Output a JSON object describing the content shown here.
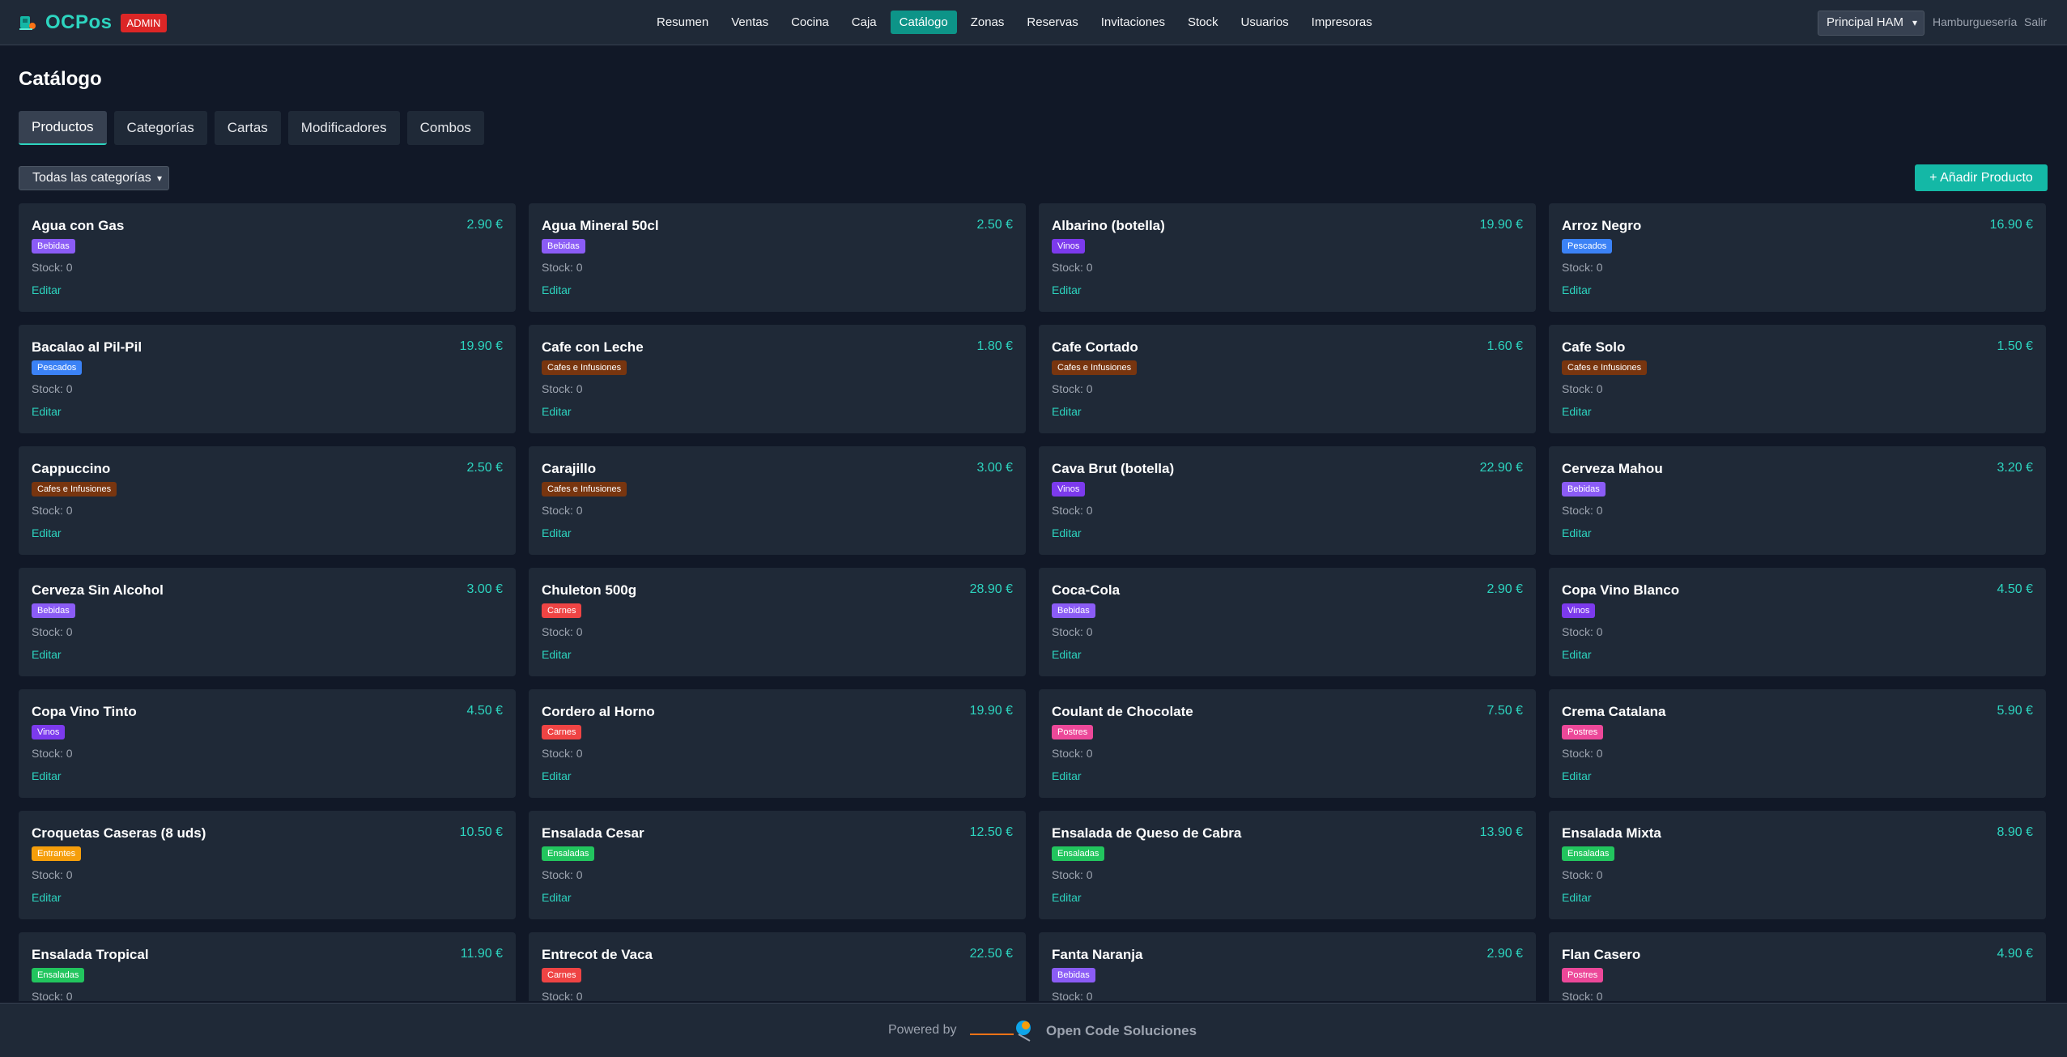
{
  "header": {
    "brand": "OCPos",
    "badge": "ADMIN",
    "nav": [
      {
        "label": "Resumen",
        "active": false
      },
      {
        "label": "Ventas",
        "active": false
      },
      {
        "label": "Cocina",
        "active": false
      },
      {
        "label": "Caja",
        "active": false
      },
      {
        "label": "Catálogo",
        "active": true
      },
      {
        "label": "Zonas",
        "active": false
      },
      {
        "label": "Reservas",
        "active": false
      },
      {
        "label": "Invitaciones",
        "active": false
      },
      {
        "label": "Stock",
        "active": false
      },
      {
        "label": "Usuarios",
        "active": false
      },
      {
        "label": "Impresoras",
        "active": false
      }
    ],
    "branch": "Principal HAM",
    "business_type": "Hamburguesería",
    "logout": "Salir"
  },
  "page": {
    "title": "Catálogo",
    "tabs": [
      {
        "label": "Productos",
        "active": true
      },
      {
        "label": "Categorías",
        "active": false
      },
      {
        "label": "Cartas",
        "active": false
      },
      {
        "label": "Modificadores",
        "active": false
      },
      {
        "label": "Combos",
        "active": false
      }
    ],
    "category_filter": "Todas las categorías",
    "add_button": "+ Añadir Producto",
    "edit_label": "Editar"
  },
  "categories": {
    "Bebidas": "#8b5cf6",
    "Vinos": "#7c3aed",
    "Pescados": "#3b82f6",
    "Cafes e Infusiones": "#78350f",
    "Carnes": "#ef4444",
    "Postres": "#ec4899",
    "Entrantes": "#f59e0b",
    "Ensaladas": "#22c55e"
  },
  "products": [
    {
      "name": "Agua con Gas",
      "price": "2.90 €",
      "category": "Bebidas",
      "stock": "Stock: 0"
    },
    {
      "name": "Agua Mineral 50cl",
      "price": "2.50 €",
      "category": "Bebidas",
      "stock": "Stock: 0"
    },
    {
      "name": "Albarino (botella)",
      "price": "19.90 €",
      "category": "Vinos",
      "stock": "Stock: 0"
    },
    {
      "name": "Arroz Negro",
      "price": "16.90 €",
      "category": "Pescados",
      "stock": "Stock: 0"
    },
    {
      "name": "Bacalao al Pil-Pil",
      "price": "19.90 €",
      "category": "Pescados",
      "stock": "Stock: 0"
    },
    {
      "name": "Cafe con Leche",
      "price": "1.80 €",
      "category": "Cafes e Infusiones",
      "stock": "Stock: 0"
    },
    {
      "name": "Cafe Cortado",
      "price": "1.60 €",
      "category": "Cafes e Infusiones",
      "stock": "Stock: 0"
    },
    {
      "name": "Cafe Solo",
      "price": "1.50 €",
      "category": "Cafes e Infusiones",
      "stock": "Stock: 0"
    },
    {
      "name": "Cappuccino",
      "price": "2.50 €",
      "category": "Cafes e Infusiones",
      "stock": "Stock: 0"
    },
    {
      "name": "Carajillo",
      "price": "3.00 €",
      "category": "Cafes e Infusiones",
      "stock": "Stock: 0"
    },
    {
      "name": "Cava Brut (botella)",
      "price": "22.90 €",
      "category": "Vinos",
      "stock": "Stock: 0"
    },
    {
      "name": "Cerveza Mahou",
      "price": "3.20 €",
      "category": "Bebidas",
      "stock": "Stock: 0"
    },
    {
      "name": "Cerveza Sin Alcohol",
      "price": "3.00 €",
      "category": "Bebidas",
      "stock": "Stock: 0"
    },
    {
      "name": "Chuleton 500g",
      "price": "28.90 €",
      "category": "Carnes",
      "stock": "Stock: 0"
    },
    {
      "name": "Coca-Cola",
      "price": "2.90 €",
      "category": "Bebidas",
      "stock": "Stock: 0"
    },
    {
      "name": "Copa Vino Blanco",
      "price": "4.50 €",
      "category": "Vinos",
      "stock": "Stock: 0"
    },
    {
      "name": "Copa Vino Tinto",
      "price": "4.50 €",
      "category": "Vinos",
      "stock": "Stock: 0"
    },
    {
      "name": "Cordero al Horno",
      "price": "19.90 €",
      "category": "Carnes",
      "stock": "Stock: 0"
    },
    {
      "name": "Coulant de Chocolate",
      "price": "7.50 €",
      "category": "Postres",
      "stock": "Stock: 0"
    },
    {
      "name": "Crema Catalana",
      "price": "5.90 €",
      "category": "Postres",
      "stock": "Stock: 0"
    },
    {
      "name": "Croquetas Caseras (8 uds)",
      "price": "10.50 €",
      "category": "Entrantes",
      "stock": "Stock: 0"
    },
    {
      "name": "Ensalada Cesar",
      "price": "12.50 €",
      "category": "Ensaladas",
      "stock": "Stock: 0"
    },
    {
      "name": "Ensalada de Queso de Cabra",
      "price": "13.90 €",
      "category": "Ensaladas",
      "stock": "Stock: 0"
    },
    {
      "name": "Ensalada Mixta",
      "price": "8.90 €",
      "category": "Ensaladas",
      "stock": "Stock: 0"
    },
    {
      "name": "Ensalada Tropical",
      "price": "11.90 €",
      "category": "Ensaladas",
      "stock": "Stock: 0"
    },
    {
      "name": "Entrecot de Vaca",
      "price": "22.50 €",
      "category": "Carnes",
      "stock": "Stock: 0"
    },
    {
      "name": "Fanta Naranja",
      "price": "2.90 €",
      "category": "Bebidas",
      "stock": "Stock: 0"
    },
    {
      "name": "Flan Casero",
      "price": "4.90 €",
      "category": "Postres",
      "stock": "Stock: 0"
    }
  ],
  "footer": {
    "powered": "Powered by",
    "company": "Open Code Soluciones"
  }
}
